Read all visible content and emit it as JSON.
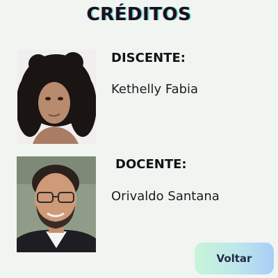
{
  "page": {
    "title": "CRÉDITOS"
  },
  "credits": [
    {
      "role": "DISCENTE:",
      "name": "Kethelly Fabia"
    },
    {
      "role": "DOCENTE:",
      "name": "Orivaldo Santana"
    }
  ],
  "actions": {
    "back_label": "Voltar"
  },
  "colors": {
    "background": "#f1f5f2",
    "title": "#15121f",
    "button_gradient_start": "#c9f4d8",
    "button_gradient_end": "#a9cdf6"
  }
}
